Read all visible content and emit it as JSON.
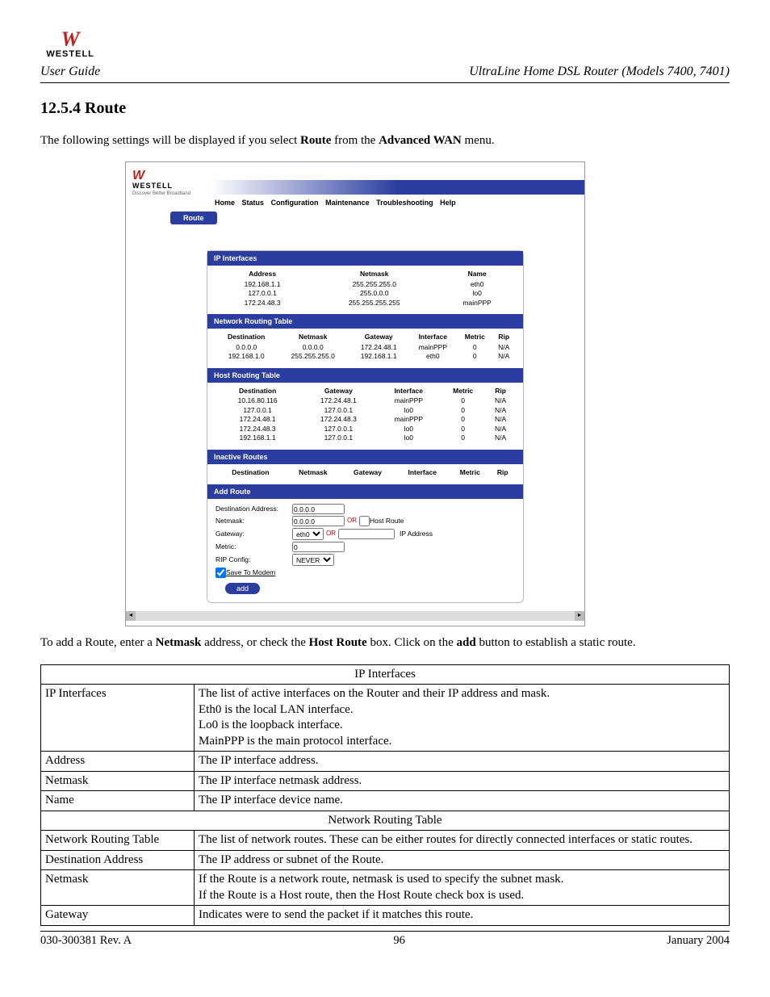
{
  "header": {
    "logo_brand": "WESTELL",
    "user_guide": "User Guide",
    "right": "UltraLine Home DSL Router (Models 7400, 7401)"
  },
  "section": {
    "number_title": "12.5.4  Route",
    "intro_pre": "The following settings will be displayed if you select ",
    "intro_b1": "Route",
    "intro_mid": " from the ",
    "intro_b2": "Advanced WAN",
    "intro_post": " menu.",
    "after_pre": "To add a Route, enter a ",
    "after_b1": "Netmask",
    "after_mid1": " address, or check the ",
    "after_b2": "Host Route",
    "after_mid2": " box. Click on the ",
    "after_b3": "add",
    "after_post": " button to establish a static route."
  },
  "ss": {
    "logo_brand": "WESTELL",
    "logo_tag": "Discover Better Broadband",
    "nav": [
      "Home",
      "Status",
      "Configuration",
      "Maintenance",
      "Troubleshooting",
      "Help"
    ],
    "tab": "Route",
    "ip_interfaces": {
      "title": "IP Interfaces",
      "cols": [
        "Address",
        "Netmask",
        "Name"
      ],
      "rows": [
        [
          "192.168.1.1",
          "255.255.255.0",
          "eth0"
        ],
        [
          "127.0.0.1",
          "255.0.0.0",
          "lo0"
        ],
        [
          "172.24.48.3",
          "255.255.255.255",
          "mainPPP"
        ]
      ]
    },
    "nrt": {
      "title": "Network Routing Table",
      "cols": [
        "Destination",
        "Netmask",
        "Gateway",
        "Interface",
        "Metric",
        "Rip"
      ],
      "rows": [
        [
          "0.0.0.0",
          "0.0.0.0",
          "172.24.48.1",
          "mainPPP",
          "0",
          "N/A"
        ],
        [
          "192.168.1.0",
          "255.255.255.0",
          "192.168.1.1",
          "eth0",
          "0",
          "N/A"
        ]
      ]
    },
    "hrt": {
      "title": "Host Routing Table",
      "cols": [
        "Destination",
        "Gateway",
        "Interface",
        "Metric",
        "Rip"
      ],
      "rows": [
        [
          "10.16.80.116",
          "172.24.48.1",
          "mainPPP",
          "0",
          "N/A"
        ],
        [
          "127.0.0.1",
          "127.0.0.1",
          "lo0",
          "0",
          "N/A"
        ],
        [
          "172.24.48.1",
          "172.24.48.3",
          "mainPPP",
          "0",
          "N/A"
        ],
        [
          "172.24.48.3",
          "127.0.0.1",
          "lo0",
          "0",
          "N/A"
        ],
        [
          "192.168.1.1",
          "127.0.0.1",
          "lo0",
          "0",
          "N/A"
        ]
      ]
    },
    "inactive": {
      "title": "Inactive Routes",
      "cols": [
        "Destination",
        "Netmask",
        "Gateway",
        "Interface",
        "Metric",
        "Rip"
      ]
    },
    "add": {
      "title": "Add Route",
      "dest_lbl": "Destination Address:",
      "dest_val": "0.0.0.0",
      "netmask_lbl": "Netmask:",
      "netmask_val": "0.0.0.0",
      "hostroute_lbl": "Host Route",
      "gateway_lbl": "Gateway:",
      "gateway_sel": "eth0",
      "ipaddr_lbl": "IP Address",
      "metric_lbl": "Metric:",
      "metric_val": "0",
      "rip_lbl": "RIP Config:",
      "rip_sel": "NEVER",
      "save_lbl": "Save To Modem",
      "add_btn": "add",
      "or": "OR"
    }
  },
  "desc_table": {
    "h1": "IP Interfaces",
    "rows1": [
      [
        "IP Interfaces",
        "The list of active interfaces on the Router and their IP address and mask.\nEth0 is the local LAN interface.\nLo0 is the loopback interface.\nMainPPP is the main protocol interface."
      ],
      [
        "Address",
        "The IP interface address."
      ],
      [
        "Netmask",
        "The IP interface netmask address."
      ],
      [
        "Name",
        "The IP interface device name."
      ]
    ],
    "h2": "Network Routing Table",
    "rows2": [
      [
        "Network Routing Table",
        "The list of network routes. These can be either routes for directly connected interfaces or static routes."
      ],
      [
        "Destination Address",
        "The IP address or subnet of the Route."
      ],
      [
        "Netmask",
        "If the Route is a network route, netmask is used to specify the subnet mask.\nIf the Route is a Host route, then the Host Route check box is used."
      ],
      [
        "Gateway",
        "Indicates were to send the packet if it matches this route."
      ]
    ]
  },
  "footer": {
    "left": "030-300381 Rev. A",
    "center": "96",
    "right": "January 2004"
  }
}
